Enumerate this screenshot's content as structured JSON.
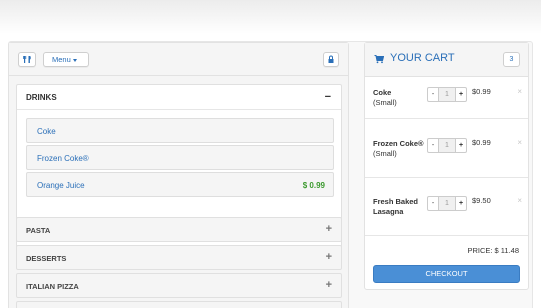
{
  "menu": {
    "toolbar": {
      "menu_label": "Menu",
      "fork_icon": "utensils-icon",
      "lock_icon": "lock-icon"
    },
    "expanded_category": {
      "name": "DRINKS",
      "toggle": "−",
      "items": [
        {
          "name": "Coke",
          "price": ""
        },
        {
          "name": "Frozen Coke®",
          "price": ""
        },
        {
          "name": "Orange Juice",
          "price": "$ 0.99"
        }
      ]
    },
    "collapsed_categories": [
      {
        "name": "PASTA",
        "toggle": "+"
      },
      {
        "name": "DESSERTS",
        "toggle": "+"
      },
      {
        "name": "ITALIAN PIZZA",
        "toggle": "+"
      }
    ]
  },
  "cart": {
    "title": "YOUR CART",
    "count": "3",
    "items": [
      {
        "name": "Coke",
        "detail": "(Small)",
        "qty": "1",
        "price": "$0.99"
      },
      {
        "name": "Frozen Coke®",
        "detail": "(Small)",
        "qty": "1",
        "price": "$0.99"
      },
      {
        "name": "Fresh Baked Lasagna",
        "detail": "",
        "qty": "1",
        "price": "$9.50"
      }
    ],
    "qty_minus": "-",
    "qty_plus": "+",
    "remove": "×",
    "total": "PRICE: $ 11.48",
    "checkout_label": "CHECKOUT"
  },
  "colors": {
    "accent": "#2a6fb8",
    "price_green": "#3c9a2f",
    "checkout_bg": "#4a8fd6"
  }
}
